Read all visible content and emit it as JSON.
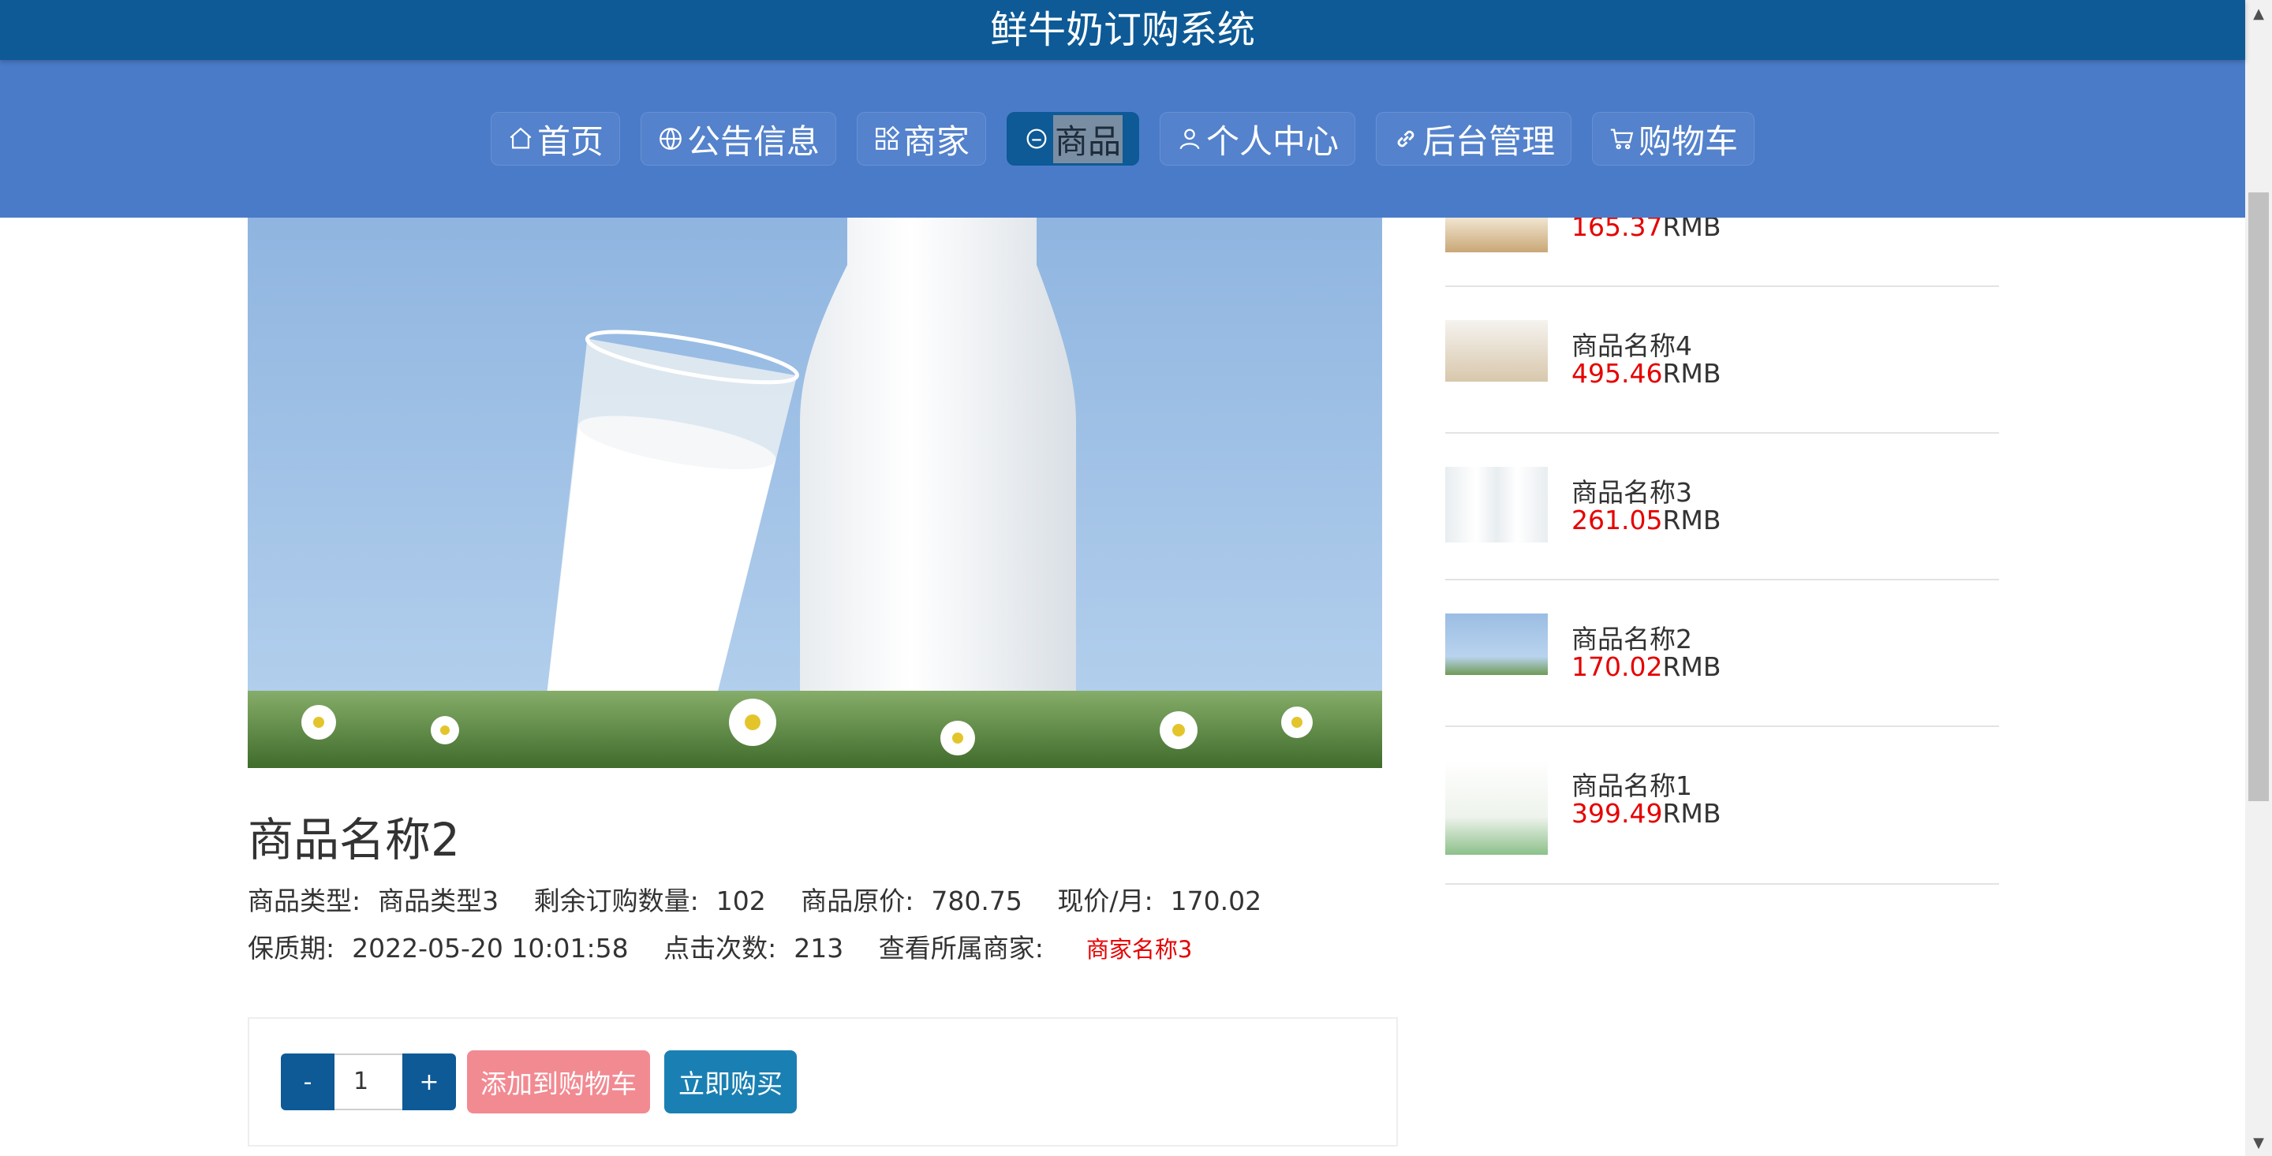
{
  "header": {
    "title": "鲜牛奶订购系统"
  },
  "nav": {
    "items": [
      {
        "label": "首页",
        "icon": "home-icon"
      },
      {
        "label": "公告信息",
        "icon": "globe-icon"
      },
      {
        "label": "商家",
        "icon": "grid-icon"
      },
      {
        "label": "商品",
        "icon": "circle-icon",
        "active": true
      },
      {
        "label": "个人中心",
        "icon": "user-icon"
      },
      {
        "label": "后台管理",
        "icon": "link-icon"
      },
      {
        "label": "购物车",
        "icon": "cart-icon"
      }
    ]
  },
  "sidebar": {
    "items": [
      {
        "name": "",
        "price": "165.37",
        "currency": "RMB"
      },
      {
        "name": "商品名称4",
        "price": "495.46",
        "currency": "RMB"
      },
      {
        "name": "商品名称3",
        "price": "261.05",
        "currency": "RMB"
      },
      {
        "name": "商品名称2",
        "price": "170.02",
        "currency": "RMB"
      },
      {
        "name": "商品名称1",
        "price": "399.49",
        "currency": "RMB"
      }
    ]
  },
  "product": {
    "name": "商品名称2",
    "type_label": "商品类型:",
    "type_value": "商品类型3",
    "stock_label": "剩余订购数量:",
    "stock_value": "102",
    "orig_price_label": "商品原价:",
    "orig_price_value": "780.75",
    "cur_price_label": "现价/月:",
    "cur_price_value": "170.02",
    "shelf_label": "保质期:",
    "shelf_value": "2022-05-20 10:01:58",
    "clicks_label": "点击次数:",
    "clicks_value": "213",
    "merchant_label": "查看所属商家:",
    "merchant_link": "商家名称3"
  },
  "buy": {
    "minus": "-",
    "quantity": "1",
    "plus": "+",
    "add_to_cart": "添加到购物车",
    "buy_now": "立即购买"
  },
  "colors": {
    "header_bg": "#0d5a96",
    "nav_bg": "#4a7bc9",
    "price_red": "#e60000",
    "cart_btn": "#f28a92",
    "buy_btn": "#1a80b3"
  }
}
